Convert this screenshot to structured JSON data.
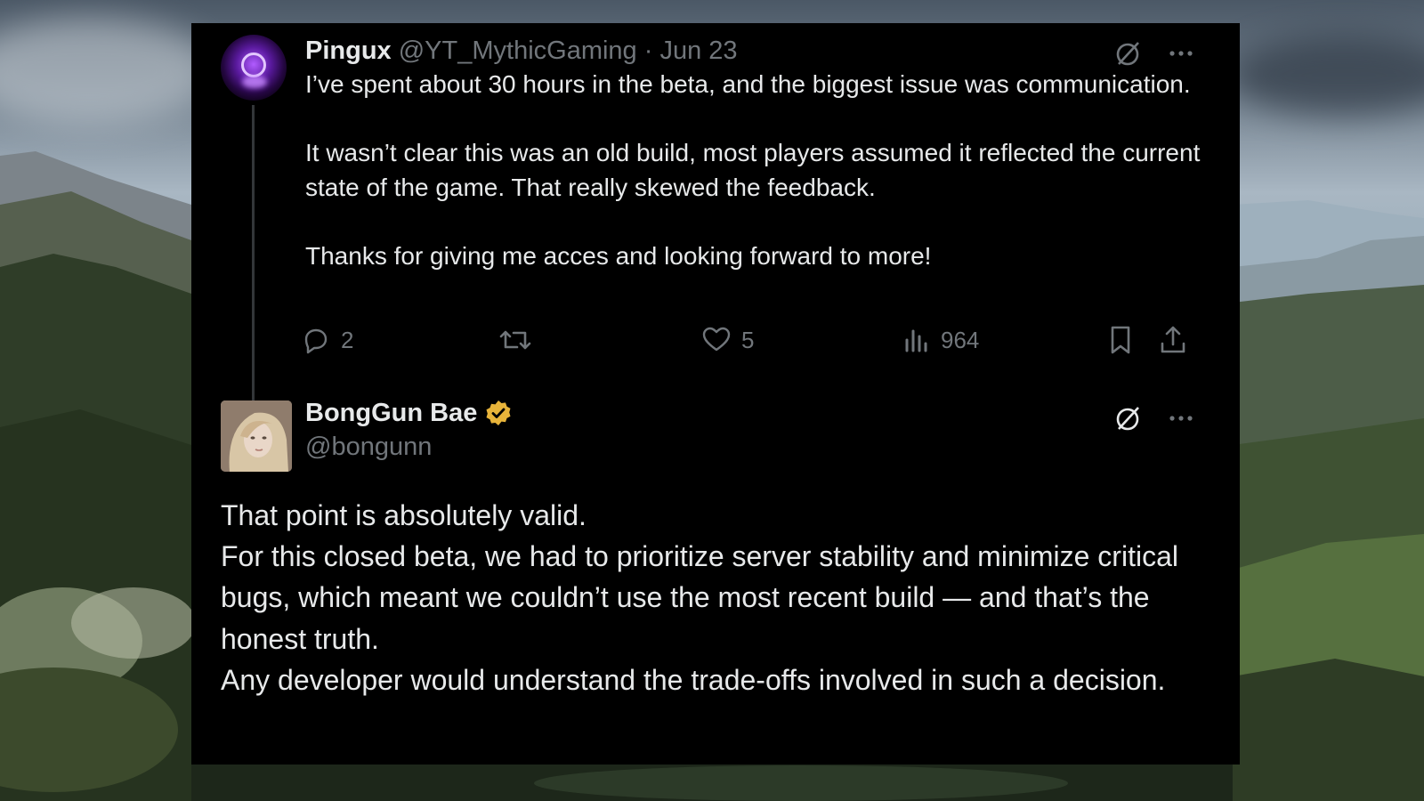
{
  "tweet1": {
    "display_name": "Pingux",
    "handle": "@YT_MythicGaming",
    "separator": "·",
    "date": "Jun 23",
    "paragraphs": [
      "I’ve spent about 30 hours in the beta, and the biggest issue was communication.",
      "It wasn’t clear this was an old build, most players assumed it reflected the current state of the game. That really skewed the feedback.",
      "Thanks for giving me acces and looking forward to more!"
    ],
    "stats": {
      "replies": "2",
      "likes": "5",
      "views": "964"
    }
  },
  "tweet2": {
    "display_name": "BongGun Bae",
    "handle": "@bongunn",
    "verified": true,
    "lines": [
      "That point is absolutely valid.",
      "For this closed beta, we had to prioritize server stability and minimize critical bugs, which meant we couldn’t use the most recent build — and that’s the honest truth.",
      "Any developer would understand the trade-offs involved in such a decision."
    ]
  },
  "icons": {
    "grok": "grok-icon",
    "more": "more-icon",
    "reply": "reply-icon",
    "retweet": "retweet-icon",
    "like": "like-icon",
    "views": "views-icon",
    "bookmark": "bookmark-icon",
    "share": "share-icon",
    "verified": "verified-badge-icon"
  },
  "colors": {
    "card_bg": "#000000",
    "text": "#e7e9ea",
    "muted": "#71767b",
    "verified_badge": "#e8b43a",
    "thread_line": "#333639"
  }
}
